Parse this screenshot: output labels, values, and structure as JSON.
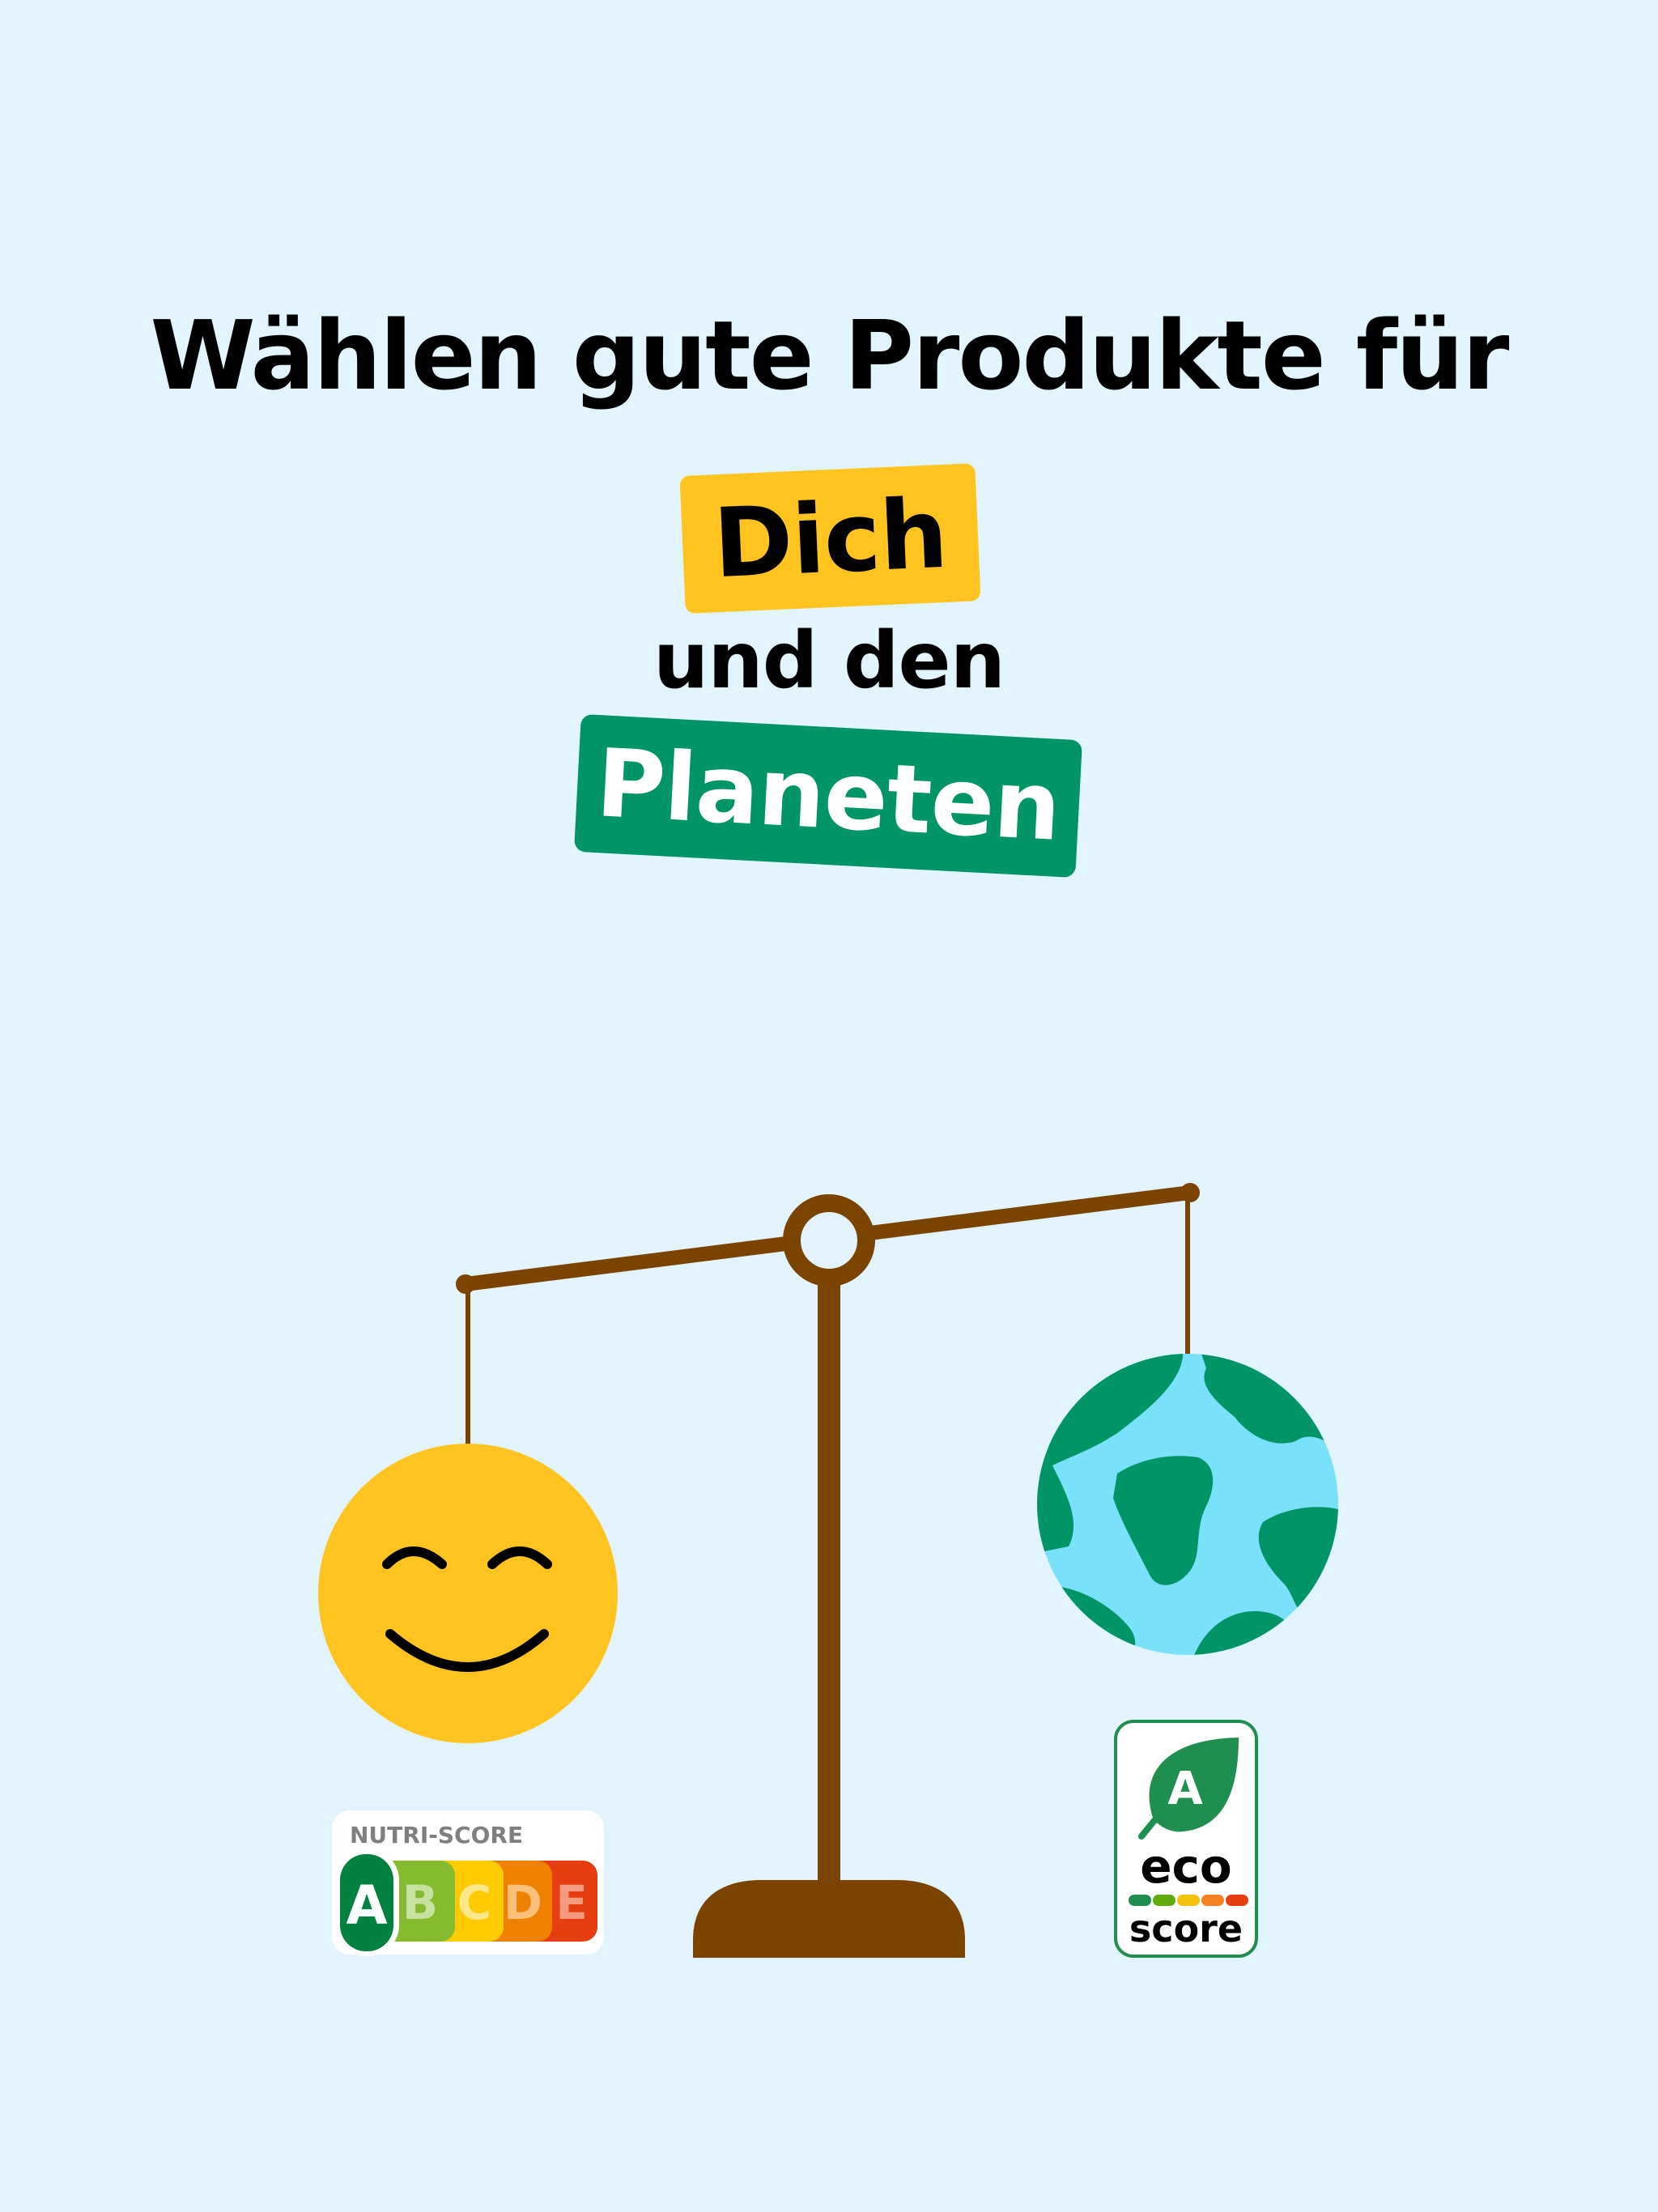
{
  "headline": {
    "line1": "Wählen gute Produkte für",
    "highlight_you": "Dich",
    "connector": "und den",
    "highlight_planet": "Planeten"
  },
  "nutri_score": {
    "title": "NUTRI-SCORE",
    "grades": [
      "A",
      "B",
      "C",
      "D",
      "E"
    ],
    "selected": "A",
    "colors": [
      "#038141",
      "#85bb2f",
      "#fecb02",
      "#ee8100",
      "#e63e11"
    ]
  },
  "eco_score": {
    "grade": "A",
    "word1": "eco",
    "word2": "score",
    "colors": [
      "#1e8f4e",
      "#60ac0e",
      "#f4c20d",
      "#f68121",
      "#e63e11"
    ]
  },
  "colors": {
    "background": "#e2f4fd",
    "yellow": "#ffc41f",
    "green": "#009466",
    "scale_brown": "#7a4300",
    "ocean": "#7ae1fb"
  },
  "icons": [
    "smiley-face-icon",
    "earth-globe-icon",
    "balance-scale-icon",
    "leaf-icon"
  ]
}
